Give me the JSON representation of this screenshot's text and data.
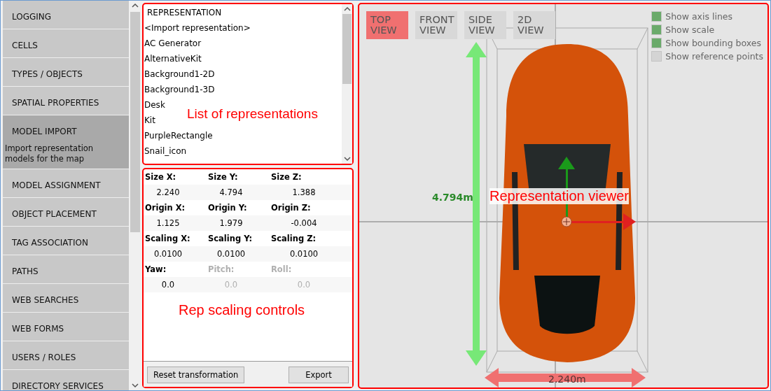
{
  "sidebar": {
    "items": [
      {
        "label": "LOGGING",
        "selected": false
      },
      {
        "label": "CELLS",
        "selected": false
      },
      {
        "label": "TYPES / OBJECTS",
        "selected": false
      },
      {
        "label": "SPATIAL PROPERTIES",
        "selected": false
      },
      {
        "label": "MODEL IMPORT",
        "selected": true,
        "description": "Import representation models for the map"
      },
      {
        "label": "MODEL ASSIGNMENT",
        "selected": false
      },
      {
        "label": "OBJECT PLACEMENT",
        "selected": false
      },
      {
        "label": "TAG ASSOCIATION",
        "selected": false
      },
      {
        "label": "PATHS",
        "selected": false
      },
      {
        "label": "WEB SEARCHES",
        "selected": false
      },
      {
        "label": "WEB FORMS",
        "selected": false
      },
      {
        "label": "USERS / ROLES",
        "selected": false
      },
      {
        "label": "DIRECTORY SERVICES",
        "selected": false
      }
    ]
  },
  "representation_list": {
    "header": "REPRESENTATION",
    "items": [
      "<Import representation>",
      "AC Generator",
      "AlternativeKit",
      "Background1-2D",
      "Background1-3D",
      "Desk",
      "Kit",
      "PurpleRectangle",
      "Snail_icon"
    ]
  },
  "fields": [
    {
      "label": "Size X:",
      "value": "2.240",
      "disabled": false
    },
    {
      "label": "Size Y:",
      "value": "4.794",
      "disabled": false
    },
    {
      "label": "Size Z:",
      "value": "1.388",
      "disabled": false
    },
    {
      "label": "Origin X:",
      "value": "1.125",
      "disabled": false
    },
    {
      "label": "Origin Y:",
      "value": "1.979",
      "disabled": false
    },
    {
      "label": "Origin Z:",
      "value": "-0.004",
      "disabled": false
    },
    {
      "label": "Scaling X:",
      "value": "0.0100",
      "disabled": false
    },
    {
      "label": "Scaling Y:",
      "value": "0.0100",
      "disabled": false
    },
    {
      "label": "Scaling Z:",
      "value": "0.0100",
      "disabled": false
    },
    {
      "label": "Yaw:",
      "value": "0.0",
      "disabled": false
    },
    {
      "label": "Pitch:",
      "value": "0.0",
      "disabled": true
    },
    {
      "label": "Roll:",
      "value": "0.0",
      "disabled": true
    }
  ],
  "buttons": [
    "Reset transformation",
    "Export"
  ],
  "viewer": {
    "views": [
      {
        "label": "TOP VIEW",
        "selected": true
      },
      {
        "label": "FRONT VIEW",
        "selected": false
      },
      {
        "label": "SIDE VIEW",
        "selected": false
      },
      {
        "label": "2D VIEW",
        "selected": false
      }
    ],
    "options": [
      {
        "label": "Show axis lines",
        "checked": true
      },
      {
        "label": "Show scale",
        "checked": true
      },
      {
        "label": "Show bounding boxes",
        "checked": true
      },
      {
        "label": "Show reference points",
        "checked": false
      }
    ],
    "length_label": "4.794m",
    "width_label": "2.240m"
  },
  "annotations": [
    "List of representations",
    "Rep scaling controls",
    "Representation viewer"
  ]
}
